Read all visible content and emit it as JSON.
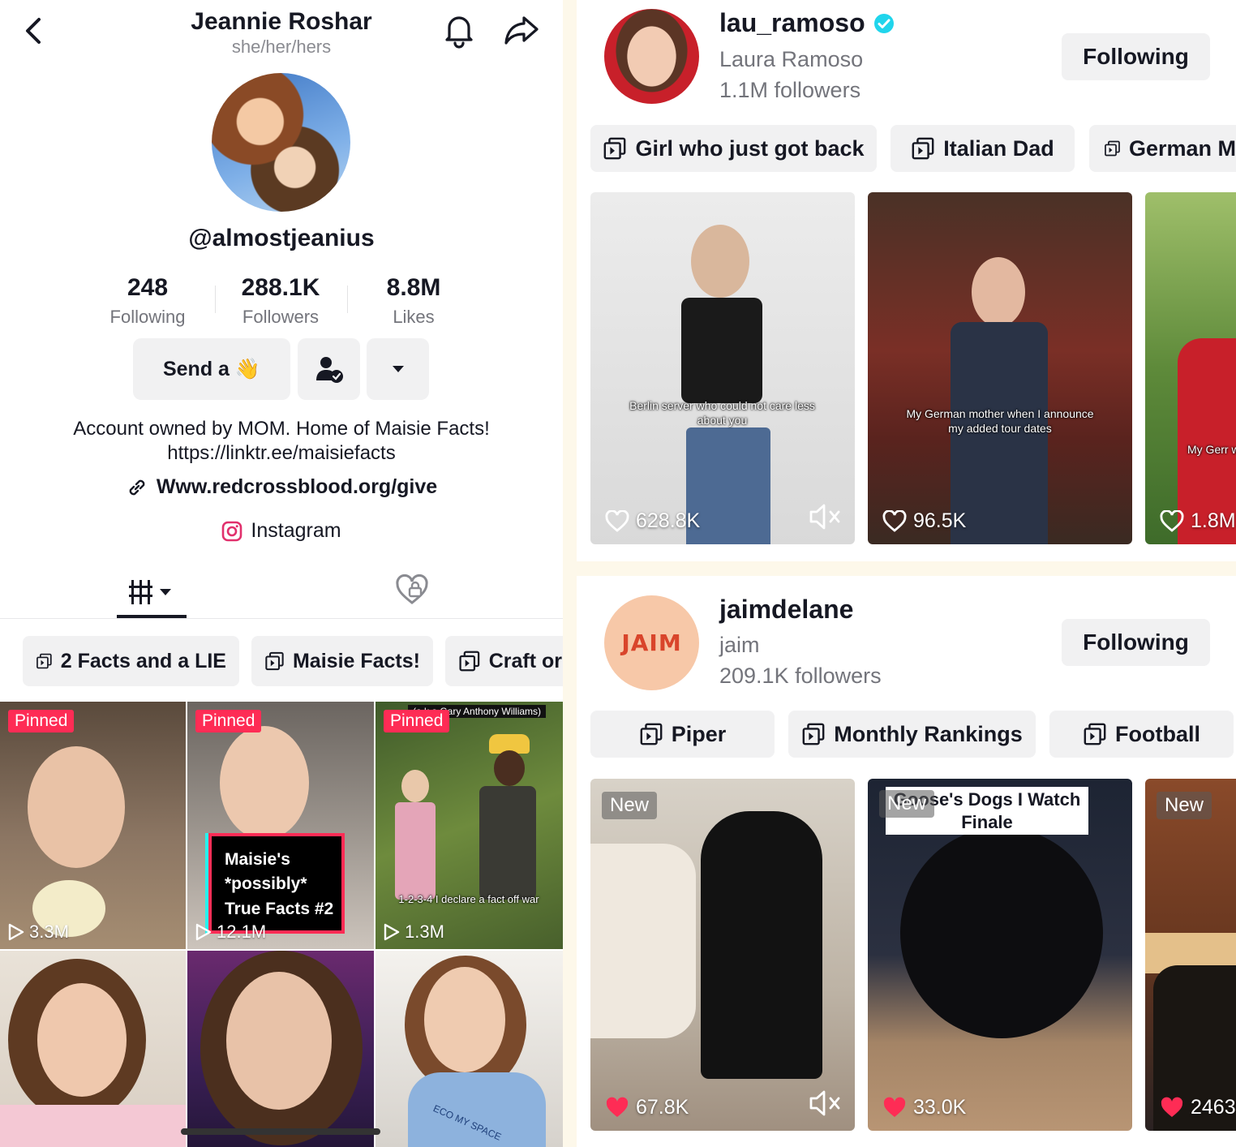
{
  "profile": {
    "name": "Jeannie Roshar",
    "pronouns": "she/her/hers",
    "username": "@almostjeanius",
    "stats": [
      {
        "value": "248",
        "label": "Following"
      },
      {
        "value": "288.1K",
        "label": "Followers"
      },
      {
        "value": "8.8M",
        "label": "Likes"
      }
    ],
    "send_button": "Send a 👋",
    "bio_line1": "Account owned by MOM. Home of Maisie Facts!",
    "bio_line2": "https://linktr.ee/maisiefacts",
    "link": "Www.redcrossblood.org/give",
    "instagram": "Instagram",
    "playlists": [
      "2 Facts and a LIE",
      "Maisie Facts!",
      "Craft or"
    ],
    "videos": [
      {
        "pinned": "Pinned",
        "views": "3.3M"
      },
      {
        "pinned": "Pinned",
        "views": "12.1M",
        "overlay": [
          "Maisie's",
          "*possibly*",
          "True Facts #2"
        ]
      },
      {
        "pinned": "Pinned",
        "views": "1.3M",
        "top_caption": "(a.k.a Gary Anthony Williams)",
        "caption": "1-2-3-4 I declare a fact off war"
      },
      {},
      {},
      {
        "shirt_text": "ECO MY SPACE"
      }
    ]
  },
  "creators": [
    {
      "handle": "lau_ramoso",
      "verified": true,
      "display_name": "Laura Ramoso",
      "followers": "1.1M followers",
      "follow_state": "Following",
      "playlists": [
        "Girl who just got back",
        "Italian Dad",
        "German M"
      ],
      "videos": [
        {
          "likes": "628.8K",
          "caption": "Berlin server who could not care less about you",
          "muted": true
        },
        {
          "likes": "96.5K",
          "caption": "My German mother when I announce my added tour dates"
        },
        {
          "likes": "1.8M",
          "caption": "My Gerr we"
        }
      ]
    },
    {
      "handle": "jaimdelane",
      "verified": false,
      "display_name": "jaim",
      "avatar_text": "JAIM",
      "followers": "209.1K followers",
      "follow_state": "Following",
      "playlists": [
        "Piper",
        "Monthly Rankings",
        "Football"
      ],
      "videos": [
        {
          "badge": "New",
          "likes": "67.8K",
          "muted": true
        },
        {
          "badge": "New",
          "likes": "33.0K",
          "caption": "Goose's Dogs I Watch Finale"
        },
        {
          "badge": "New",
          "likes": "2463"
        }
      ]
    }
  ],
  "colors": {
    "accent": "#fe2c55",
    "verified": "#20d5ec",
    "chip_bg": "#f1f1f2",
    "divider": "#fdf8ea"
  }
}
